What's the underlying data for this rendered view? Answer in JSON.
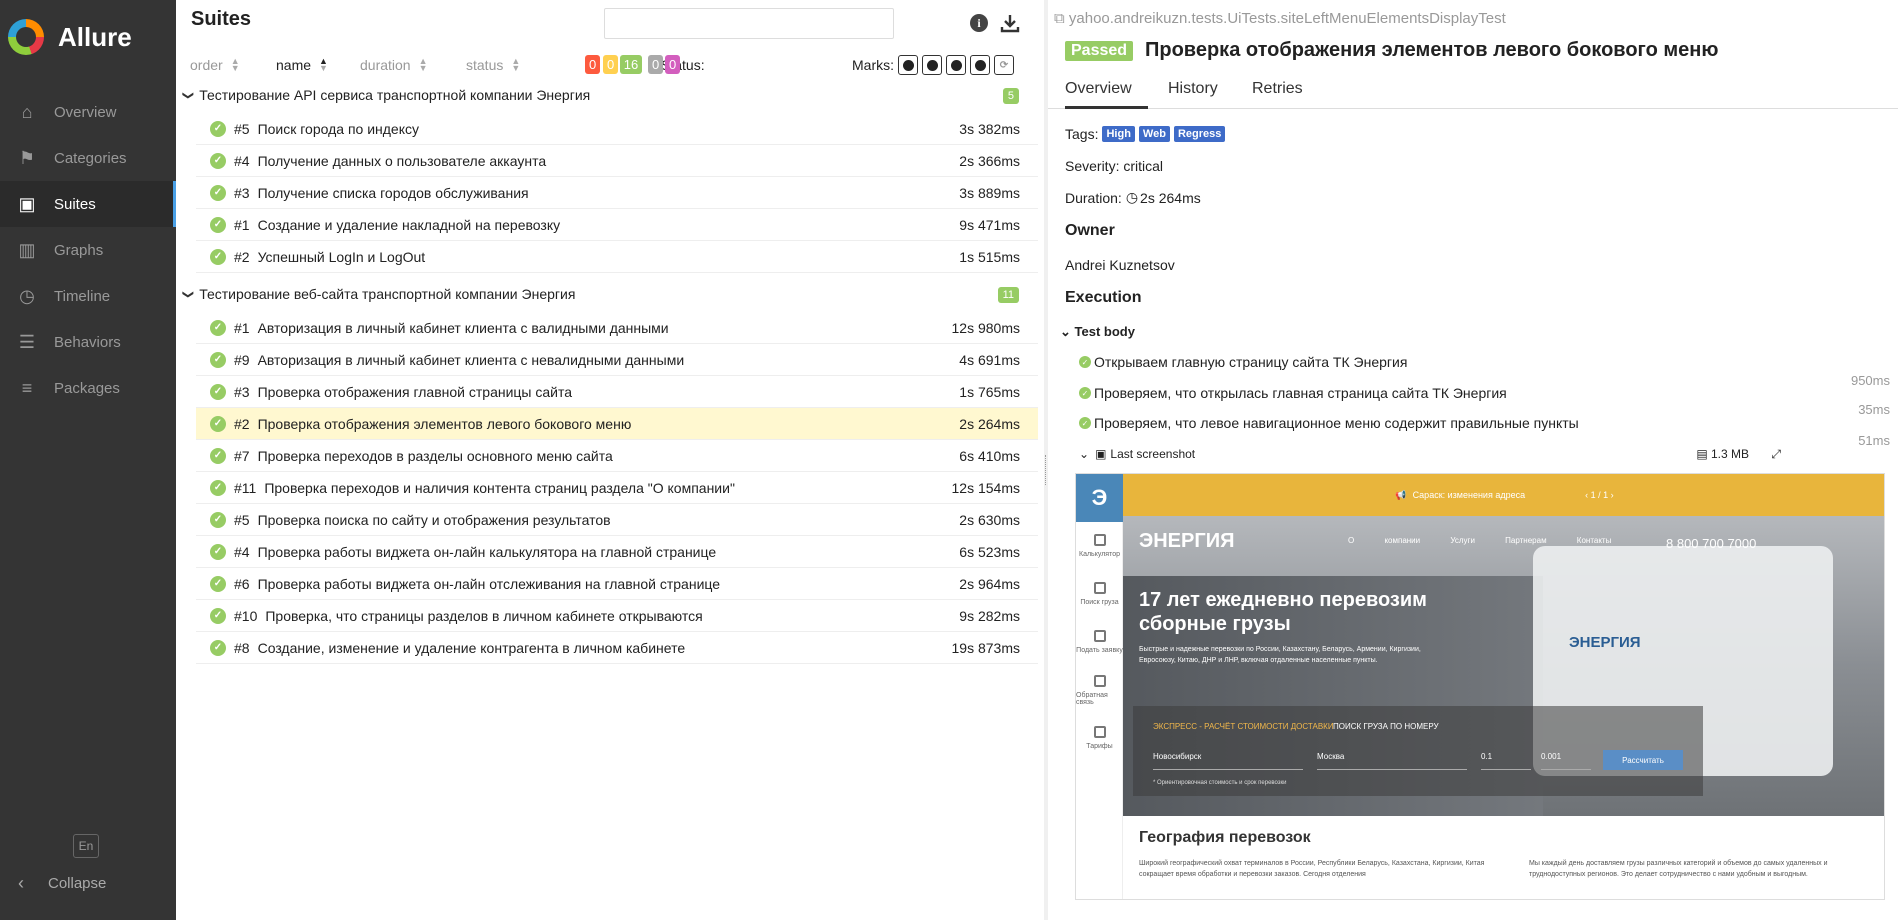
{
  "app": {
    "name": "Allure"
  },
  "sidebar": {
    "items": [
      {
        "label": "Overview",
        "icon": "home-icon"
      },
      {
        "label": "Categories",
        "icon": "flag-icon"
      },
      {
        "label": "Suites",
        "icon": "briefcase-icon",
        "active": true
      },
      {
        "label": "Graphs",
        "icon": "bar-chart-icon"
      },
      {
        "label": "Timeline",
        "icon": "clock-icon"
      },
      {
        "label": "Behaviors",
        "icon": "list-icon"
      },
      {
        "label": "Packages",
        "icon": "align-left-icon"
      }
    ],
    "lang": "En",
    "collapse": "Collapse"
  },
  "suites": {
    "title": "Suites",
    "search_value": "",
    "sort": {
      "order": "order",
      "name": "name",
      "duration": "duration",
      "status": "status"
    },
    "status_label": "Status:",
    "status_counts": [
      {
        "value": "0",
        "color": "#fd5a3e"
      },
      {
        "value": "0",
        "color": "#ffd050"
      },
      {
        "value": "16",
        "color": "#97cc64"
      },
      {
        "value": "0",
        "color": "#aaaaaa"
      },
      {
        "value": "0",
        "color": "#d35ebe"
      }
    ],
    "marks_label": "Marks:",
    "groups": [
      {
        "name": "Тестирование API сервиса транспортной компании Энергия",
        "count": "5",
        "tests": [
          {
            "num": "#5",
            "name": "Поиск города по индексу",
            "duration": "3s 382ms"
          },
          {
            "num": "#4",
            "name": "Получение данных о пользователе аккаунта",
            "duration": "2s 366ms"
          },
          {
            "num": "#3",
            "name": "Получение списка городов обслуживания",
            "duration": "3s 889ms"
          },
          {
            "num": "#1",
            "name": "Создание и удаление накладной на перевозку",
            "duration": "9s 471ms"
          },
          {
            "num": "#2",
            "name": "Успешный LogIn и LogOut",
            "duration": "1s 515ms"
          }
        ]
      },
      {
        "name": "Тестирование веб-сайта транспортной компании Энергия",
        "count": "11",
        "tests": [
          {
            "num": "#1",
            "name": "Авторизация в личный кабинет клиента с валидными данными",
            "duration": "12s 980ms"
          },
          {
            "num": "#9",
            "name": "Авторизация в личный кабинет клиента с невалидными данными",
            "duration": "4s 691ms"
          },
          {
            "num": "#3",
            "name": "Проверка отображения главной страницы сайта",
            "duration": "1s 765ms"
          },
          {
            "num": "#2",
            "name": "Проверка отображения элементов левого бокового меню",
            "duration": "2s 264ms",
            "selected": true
          },
          {
            "num": "#7",
            "name": "Проверка переходов в разделы основного меню сайта",
            "duration": "6s 410ms"
          },
          {
            "num": "#11",
            "name": "Проверка переходов и наличия контента страниц раздела \"О компании\"",
            "duration": "12s 154ms"
          },
          {
            "num": "#5",
            "name": "Проверка поиска по сайту и отображения результатов",
            "duration": "2s 630ms"
          },
          {
            "num": "#4",
            "name": "Проверка работы виджета он-лайн калькулятора на главной странице",
            "duration": "6s 523ms"
          },
          {
            "num": "#6",
            "name": "Проверка работы виджета он-лайн отслеживания на главной странице",
            "duration": "2s 964ms"
          },
          {
            "num": "#10",
            "name": "Проверка, что страницы разделов в личном кабинете открываются",
            "duration": "9s 282ms"
          },
          {
            "num": "#8",
            "name": "Создание, изменение и удаление контрагента в личном кабинете",
            "duration": "19s 873ms"
          }
        ]
      }
    ]
  },
  "detail": {
    "breadcrumb": "yahoo.andreikuzn.tests.UiTests.siteLeftMenuElementsDisplayTest",
    "status": "Passed",
    "title": "Проверка отображения элементов левого бокового меню",
    "tabs": [
      "Overview",
      "History",
      "Retries"
    ],
    "tags_label": "Tags:",
    "tags": [
      "High",
      "Web",
      "Regress"
    ],
    "severity": "Severity: critical",
    "duration_label": "Duration:",
    "duration": "2s 264ms",
    "owner_heading": "Owner",
    "owner": "Andrei Kuznetsov",
    "execution_heading": "Execution",
    "test_body": "Test body",
    "steps": [
      {
        "name": "Открываем главную страницу сайта ТК Энергия",
        "duration": "950ms"
      },
      {
        "name": "Проверяем, что открылась главная страница сайта ТК Энергия",
        "duration": "35ms"
      },
      {
        "name": "Проверяем, что левое навигационное меню содержит правильные пункты",
        "duration": "51ms"
      }
    ],
    "attachment": {
      "name": "Last screenshot",
      "size": "1.3 MB"
    }
  },
  "screenshot": {
    "banner": "Сараск: изменения адреса",
    "banner_pager": "‹  1 / 1  ›",
    "brand": "ЭНЕРГИЯ",
    "menu": "О компании Услуги Партнерам Контакты",
    "phone": "8 800 700 7000",
    "headline": "17 лет ежедневно перевозим сборные грузы",
    "subline": "Быстрые и надежные перевозки по России, Казахстану, Беларусь, Армении, Киргизии, Евросоюзу, Китаю, ДНР и ЛНР, включая отдаленные населенные пункты.",
    "truck_brand": "ЭНЕРГИЯ",
    "calc_title": "ЭКСПРЕСС - РАСЧЁТ СТОИМОСТИ ДОСТАВКИ",
    "track_title": "ПОИСК ГРУЗА ПО НОМЕРУ",
    "from": "Новосибирск",
    "to": "Москва",
    "weight": "0.1",
    "volume": "0.001",
    "calc_button": "Рассчитать",
    "calc_note": "* Ориентировочная стоимость и срок перевозки",
    "side_items": [
      "Калькулятор",
      "Поиск груза",
      "Подать заявку",
      "Обратная связь",
      "Тарифы"
    ],
    "geo_title": "География перевозок",
    "geo_p1": "Широкий географический охват терминалов в России, Республики Беларусь, Казахстана, Киргизии, Китая сокращает время обработки и перевозки заказов. Сегодня отделения",
    "geo_p2": "Мы каждый день доставляем грузы различных категорий и объемов до самых удаленных и труднодоступных регионов. Это делает сотрудничество с нами удобным и выгодным."
  }
}
